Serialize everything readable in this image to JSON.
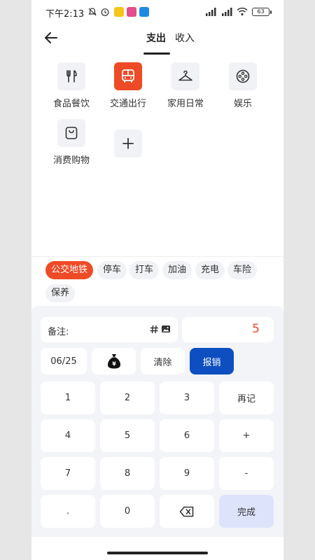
{
  "status": {
    "time": "下午2:13",
    "battery": "63",
    "badge_colors": [
      "#f5c518",
      "#e24d8a",
      "#1e88e5"
    ]
  },
  "header": {
    "tabs": [
      "支出",
      "收入"
    ],
    "active_tab": "支出",
    "back_icon": "arrow-left-icon"
  },
  "categories": [
    {
      "label": "食品餐饮",
      "icon": "fork-knife-icon",
      "active": false
    },
    {
      "label": "交通出行",
      "icon": "bus-icon",
      "active": true
    },
    {
      "label": "家用日常",
      "icon": "hanger-icon",
      "active": false
    },
    {
      "label": "娱乐",
      "icon": "film-reel-icon",
      "active": false
    },
    {
      "label": "消费购物",
      "icon": "shopping-bag-icon",
      "active": false
    },
    {
      "label": "",
      "icon": "plus-icon",
      "active": false
    }
  ],
  "subcategories": [
    "公交地铁",
    "停车",
    "打车",
    "加油",
    "充电",
    "车险",
    "保养"
  ],
  "active_subcategory": "公交地铁",
  "colors": {
    "accent": "#ef4a26",
    "primary_button": "#0d4fc1",
    "done_key": "#dce3fb"
  },
  "input": {
    "note_label": "备注:",
    "amount": "5"
  },
  "controls": {
    "date": "06/25",
    "money_bag_icon": "money-bag-icon",
    "clear": "清除",
    "reimburse": "报销"
  },
  "keypad": [
    [
      "1",
      "2",
      "3",
      "再记"
    ],
    [
      "4",
      "5",
      "6",
      "+"
    ],
    [
      "7",
      "8",
      "9",
      "-"
    ],
    [
      ".",
      "0",
      "backspace-icon",
      "完成"
    ]
  ]
}
